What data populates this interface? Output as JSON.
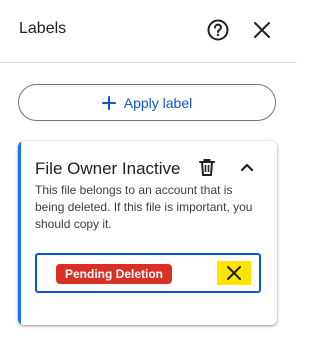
{
  "header": {
    "title": "Labels"
  },
  "apply_label": "Apply label",
  "card": {
    "title": "File Owner Inactive",
    "description": "This file belongs to an account that is being deleted. If this file is important, you should copy it.",
    "chip_label": "Pending Deletion"
  },
  "colors": {
    "accent": "#1a73e8",
    "chip": "#d93025",
    "highlight": "#ffe400",
    "apply_text": "#0b57d0"
  },
  "icons": {
    "help": "help-circle-icon",
    "close": "close-icon",
    "add": "plus-icon",
    "delete": "trash-icon",
    "collapse": "chevron-up-icon",
    "remove": "x-icon"
  }
}
